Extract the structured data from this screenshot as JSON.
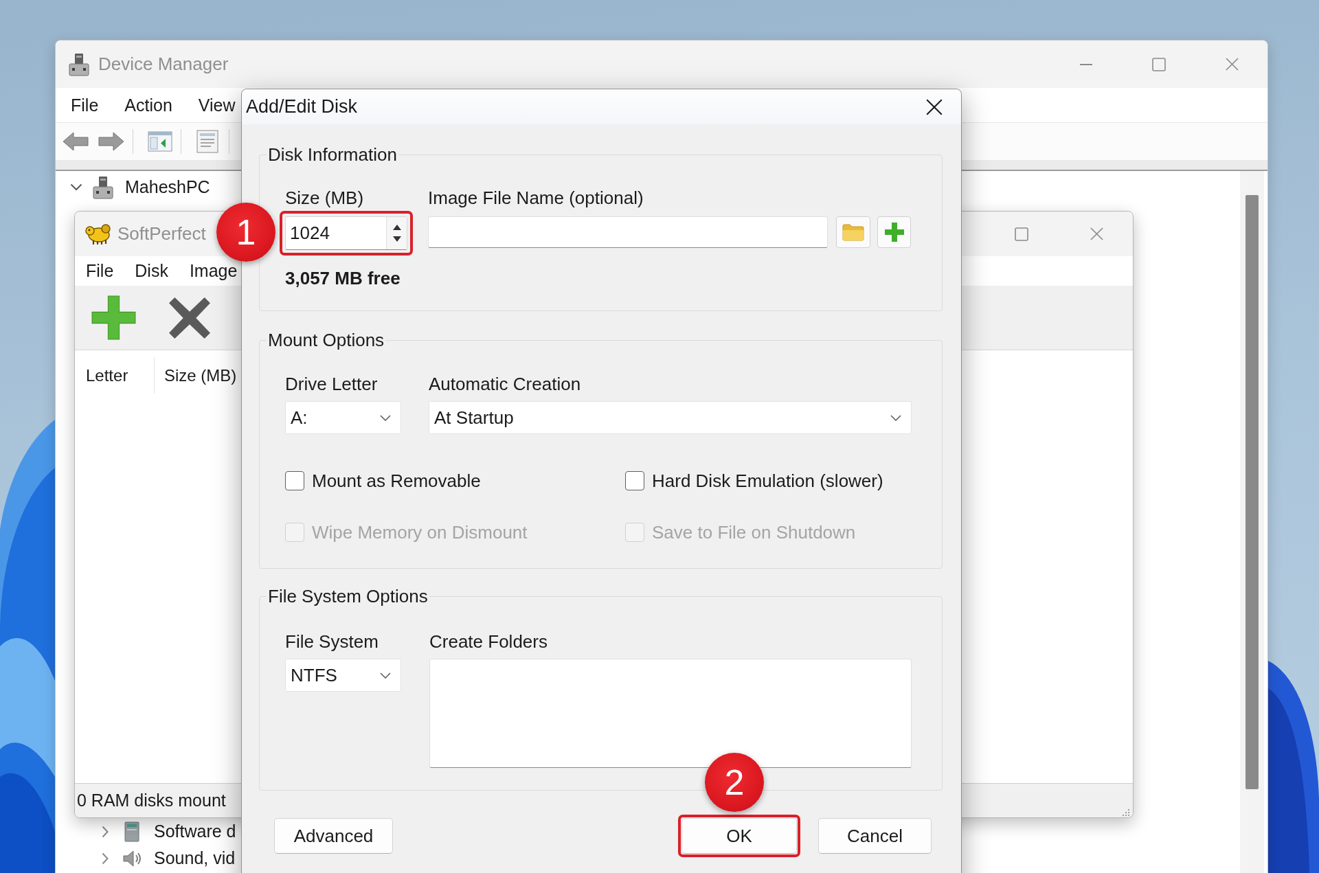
{
  "device_manager": {
    "title": "Device Manager",
    "active": false,
    "menu": [
      {
        "label": "File"
      },
      {
        "label": "Action"
      },
      {
        "label": "View"
      }
    ],
    "tree": [
      {
        "label": "MaheshPC",
        "kind": "computer",
        "expanded": true,
        "children": [
          {
            "label": "Software d",
            "kind": "software",
            "expanded": false
          },
          {
            "label": "Sound, vid",
            "kind": "sound",
            "expanded": false
          }
        ]
      }
    ]
  },
  "ram_disk_window": {
    "title": "SoftPerfect",
    "active": false,
    "menu": [
      {
        "label": "File"
      },
      {
        "label": "Disk"
      },
      {
        "label": "Image"
      }
    ],
    "columns": [
      {
        "label": "Letter"
      },
      {
        "label": "Size (MB)"
      }
    ],
    "status_bar": "0 RAM disks mount"
  },
  "dialog": {
    "title": "Add/Edit Disk",
    "active": true,
    "disk_information": {
      "title": "Disk Information",
      "size": {
        "label": "Size (MB)",
        "value": "1024",
        "annotation": "1"
      },
      "image_file": {
        "label": "Image File Name (optional)"
      },
      "free_space": "3,057 MB free"
    },
    "mount_options": {
      "title": "Mount Options",
      "drive_letter": {
        "label": "Drive Letter",
        "value": "A:"
      },
      "automatic_creation": {
        "label": "Automatic Creation",
        "value": "At Startup"
      },
      "options": [
        {
          "label": "Mount as Removable",
          "checked": false,
          "disabled": false
        },
        {
          "label": "Hard Disk Emulation (slower)",
          "checked": false,
          "disabled": false
        },
        {
          "label": "Wipe Memory on Dismount",
          "checked": false,
          "disabled": true
        },
        {
          "label": "Save to File on Shutdown",
          "checked": false,
          "disabled": true
        }
      ]
    },
    "file_system_options": {
      "title": "File System Options",
      "file_system": {
        "label": "File System",
        "value": "NTFS"
      },
      "create_folders": {
        "label": "Create Folders"
      }
    },
    "buttons": [
      {
        "label": "Advanced"
      },
      {
        "label": "OK",
        "annotation": "2"
      },
      {
        "label": "Cancel"
      }
    ]
  }
}
